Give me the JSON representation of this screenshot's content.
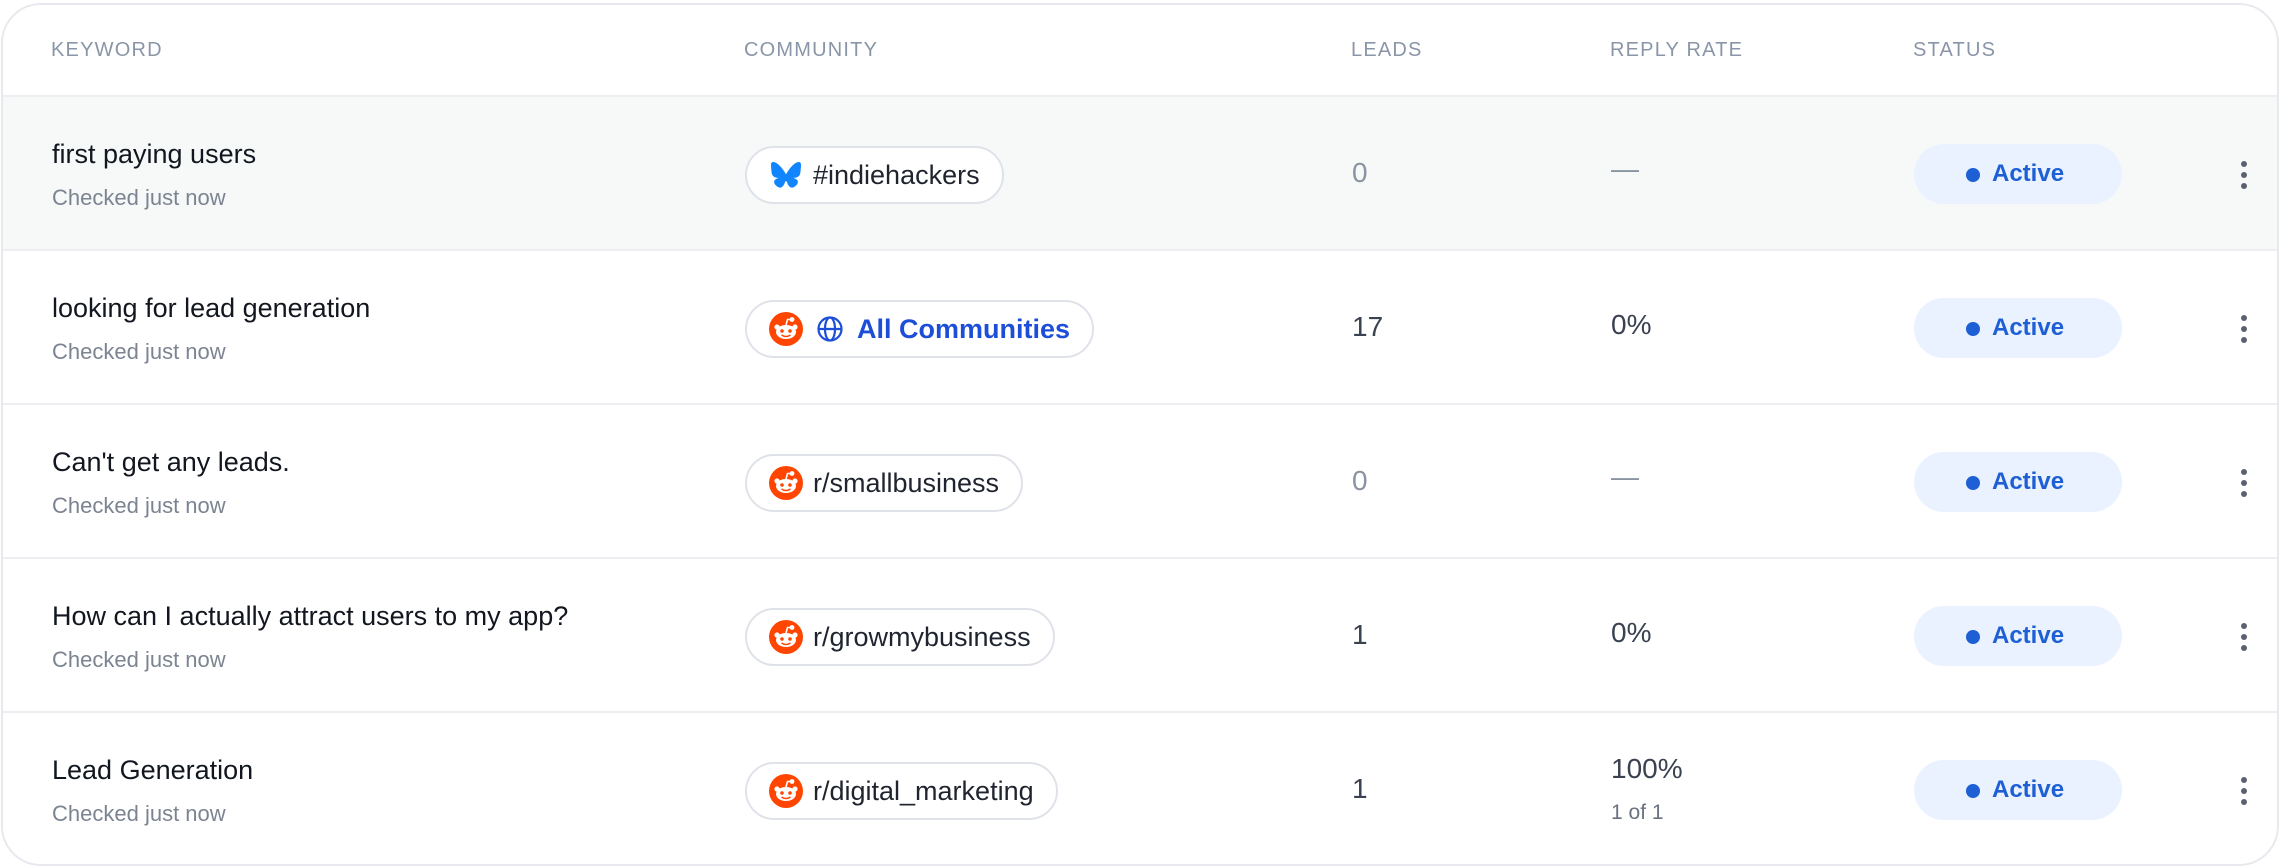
{
  "table": {
    "columns": {
      "keyword": "KEYWORD",
      "community": "COMMUNITY",
      "leads": "LEADS",
      "reply_rate": "REPLY RATE",
      "status": "STATUS"
    },
    "rows": [
      {
        "keyword": "first paying users",
        "checked": "Checked just now",
        "community": "#indiehackers",
        "community_icon": "bluesky-icon",
        "leads": "0",
        "reply_rate": "—",
        "reply_detail": "",
        "status": "Active",
        "highlighted": true
      },
      {
        "keyword": "looking for lead generation",
        "checked": "Checked just now",
        "community": "All Communities",
        "community_icon": "reddit-icon",
        "leads": "17",
        "reply_rate": "0%",
        "reply_detail": "",
        "status": "Active"
      },
      {
        "keyword": "Can't get any leads.",
        "checked": "Checked just now",
        "community": "r/smallbusiness",
        "community_icon": "reddit-icon",
        "leads": "0",
        "reply_rate": "—",
        "reply_detail": "",
        "status": "Active"
      },
      {
        "keyword": "How can I actually attract users to my app?",
        "checked": "Checked just now",
        "community": "r/growmybusiness",
        "community_icon": "reddit-icon",
        "leads": "1",
        "reply_rate": "0%",
        "reply_detail": "",
        "status": "Active"
      },
      {
        "keyword": "Lead Generation",
        "checked": "Checked just now",
        "community": "r/digital_marketing",
        "community_icon": "reddit-icon",
        "leads": "1",
        "reply_rate": "100%",
        "reply_detail": "1 of 1",
        "status": "Active"
      }
    ]
  },
  "colors": {
    "status_active": "#1f5fd6",
    "status_bg": "#e9f2fe",
    "reddit": "#ff4500",
    "bluesky": "#1185fe",
    "link_blue": "#1d4ed8"
  }
}
